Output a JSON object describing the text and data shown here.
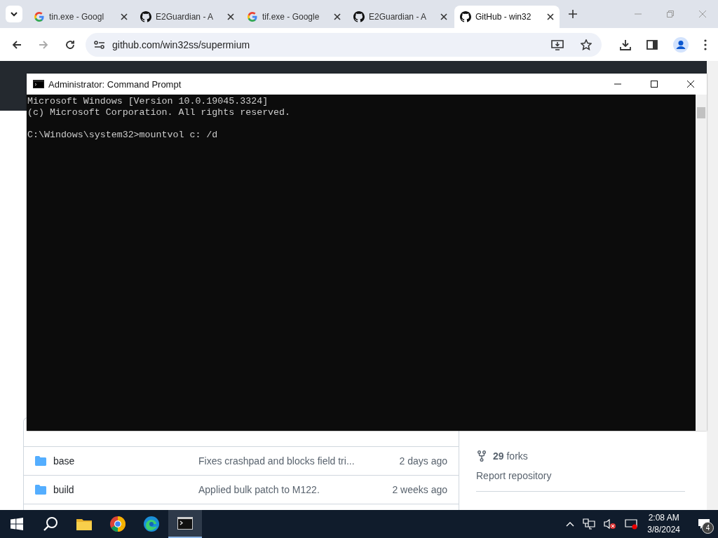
{
  "browser": {
    "tabs": [
      {
        "title": "tin.exe - Googl",
        "kind": "google",
        "selected": false
      },
      {
        "title": "E2Guardian - A",
        "kind": "github",
        "selected": false
      },
      {
        "title": "tif.exe - Google",
        "kind": "google",
        "selected": false
      },
      {
        "title": "E2Guardian - A",
        "kind": "github",
        "selected": false
      },
      {
        "title": "GitHub - win32",
        "kind": "github",
        "selected": true
      }
    ],
    "address": "github.com/win32ss/supermium"
  },
  "page": {
    "files": [
      {
        "name": "base",
        "message": "Fixes crashpad and blocks field tri...",
        "time": "2 days ago"
      },
      {
        "name": "build",
        "message": "Applied bulk patch to M122.",
        "time": "2 weeks ago"
      }
    ],
    "forks": "**29** forks",
    "report": "Report repository"
  },
  "console": {
    "title": "Administrator: Command Prompt",
    "blocks": [
      [
        "Microsoft Windows [Version 10.0.19045.3324]",
        "(c) Microsoft Corporation. All rights reserved."
      ],
      [
        "C:\\Windows\\system32>mountvol c: /d"
      ]
    ]
  },
  "taskbar": {
    "apps": [
      {
        "kind": "start",
        "active": false
      },
      {
        "kind": "search",
        "active": false
      },
      {
        "kind": "explorer",
        "active": false
      },
      {
        "kind": "chrome",
        "active": false
      },
      {
        "kind": "edge",
        "active": false
      },
      {
        "kind": "terminal",
        "active": true
      }
    ],
    "time": "2:08 AM",
    "date": "3/8/2024",
    "notifications": "4"
  }
}
